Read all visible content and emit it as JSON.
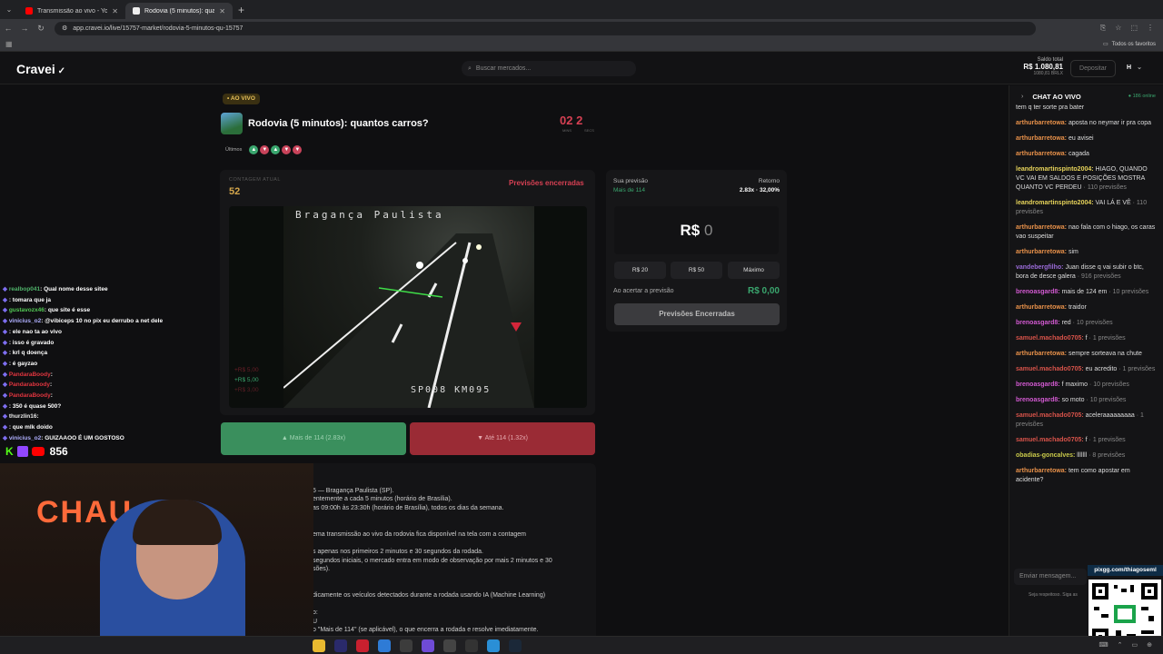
{
  "browser": {
    "tabs": [
      {
        "label": "Transmissão ao vivo - YouTube",
        "active": false
      },
      {
        "label": "Rodovia (5 minutos): quantos c",
        "active": true
      }
    ],
    "url": "app.cravei.io/live/15757-market/rodovia-5-minutos-qu-15757",
    "bookmarks_all": "Todos os favoritos"
  },
  "header": {
    "logo": "Cravei",
    "search_placeholder": "Buscar mercados...",
    "balance_label": "Saldo total",
    "balance_value": "R$ 1.080,81",
    "balance_sub": "1080,81 BRLX",
    "deposit_label": "Depositar",
    "avatar": "H"
  },
  "market": {
    "live_tag": "• AO VIVO",
    "title": "Rodovia (5 minutos): quantos carros?",
    "timer_min": "02",
    "timer_sec": "2",
    "timer_min_label": "MINS",
    "timer_sec_label": "SECS",
    "ultimos_label": "Últimos",
    "ultimos": [
      "up",
      "down",
      "up",
      "down",
      "down"
    ],
    "contagem_label": "CONTAGEM ATUAL",
    "contagem_value": "52",
    "status": "Previsões encerradas",
    "cam_top": "Bragança Paulista",
    "cam_bottom": "SP008 KM095",
    "odds": [
      "+R$ 5,00",
      "+R$ 5,00",
      "+R$ 3,00"
    ],
    "btn_mais": "Mais de 114 (2.83x)",
    "btn_ate": "Até 114 (1.32x)"
  },
  "description": [
    "5 — Bragança Paulista (SP).",
    "entemente a cada 5 minutos (horário de Brasília).",
    "as 09:00h às 23:30h (horário de Brasília), todos os dias da semana.",
    "ema transmissão ao vivo da rodovia fica disponível na tela com a contagem",
    "s apenas nos primeiros 2 minutos e 30 segundos da rodada.",
    "segundos iniciais, o mercado entra em modo de observação por mais 2 minutos e 30",
    "sões).",
    "dicamente os veículos detectados durante a rodada usando IA (Machine Learning)",
    "o:",
    "U",
    "o \"Mais de 114\" (se aplicável), o que encerra a rodada e resolve imediatamente."
  ],
  "prediction": {
    "sua_label": "Sua previsão",
    "sua_value": "Mais de 114",
    "retorno_label": "Retorno",
    "retorno_value": "2.83x · 32,00%",
    "amount_prefix": "R$",
    "amount_value": "0",
    "chips": [
      "R$ 20",
      "R$ 50",
      "Máximo"
    ],
    "ao_acertar_label": "Ao acertar a previsão",
    "ao_acertar_value": "R$ 0,00",
    "button": "Previsões Encerradas"
  },
  "chat": {
    "title": "CHAT AO VIVO",
    "online": "186 online",
    "messages": [
      {
        "user": "",
        "text": "tem q ter sorte pra bater",
        "color": "#dddddd",
        "pred": ""
      },
      {
        "user": "arthurbarretowa:",
        "text": " aposta no neymar ir pra copa",
        "color": "#e8914a",
        "pred": ""
      },
      {
        "user": "arthurbarretowa:",
        "text": " eu avisei",
        "color": "#e8914a",
        "pred": ""
      },
      {
        "user": "arthurbarretowa:",
        "text": " cagada",
        "color": "#e8914a",
        "pred": ""
      },
      {
        "user": "leandromartinspinto2004:",
        "text": " HIAGO, QUANDO VC VAI EM SALDOS E POSIÇÕES MOSTRA QUANTO VC PERDEU",
        "color": "#e6d35a",
        "pred": " · 110 previsões"
      },
      {
        "user": "leandromartinspinto2004:",
        "text": " VAI LÁ E VÊ",
        "color": "#e6d35a",
        "pred": " · 110 previsões"
      },
      {
        "user": "arthurbarretowa:",
        "text": " nao fala com o hiago, os caras vao suspeitar",
        "color": "#e8914a",
        "pred": ""
      },
      {
        "user": "arthurbarretowa:",
        "text": " sim",
        "color": "#e8914a",
        "pred": ""
      },
      {
        "user": "vandebergfilho:",
        "text": " Juan disse q vai subir o btc, bora de desce galera",
        "color": "#9a6bd8",
        "pred": " · 916 previsões"
      },
      {
        "user": "brenoasgard8:",
        "text": " mais de 124 em",
        "color": "#d35ad2",
        "pred": " · 10 previsões"
      },
      {
        "user": "arthurbarretowa:",
        "text": " traidor",
        "color": "#e8914a",
        "pred": ""
      },
      {
        "user": "brenoasgard8:",
        "text": " red",
        "color": "#d35ad2",
        "pred": " · 10 previsões"
      },
      {
        "user": "samuel.machado0705:",
        "text": " f",
        "color": "#d8534a",
        "pred": " · 1 previsões"
      },
      {
        "user": "arthurbarretowa:",
        "text": " sempre sorteava na chute",
        "color": "#e8914a",
        "pred": ""
      },
      {
        "user": "samuel.machado0705:",
        "text": " eu acredito",
        "color": "#d8534a",
        "pred": " · 1 previsões"
      },
      {
        "user": "brenoasgard8:",
        "text": " f maximo",
        "color": "#d35ad2",
        "pred": " · 10 previsões"
      },
      {
        "user": "brenoasgard8:",
        "text": " so moto",
        "color": "#d35ad2",
        "pred": " · 10 previsões"
      },
      {
        "user": "samuel.machado0705:",
        "text": " aceleraaaaaaaaa",
        "color": "#d8534a",
        "pred": " · 1 previsões"
      },
      {
        "user": "samuel.machado0705:",
        "text": " f",
        "color": "#d8534a",
        "pred": " · 1 previsões"
      },
      {
        "user": "obadias-goncalves:",
        "text": " lllllll",
        "color": "#c9c94a",
        "pred": " · 8 previsões"
      },
      {
        "user": "arthurbarretowa:",
        "text": " tem como apostar em acidente?",
        "color": "#e8914a",
        "pred": ""
      }
    ],
    "input_placeholder": "Enviar mensagem...",
    "note": "Seja respeitoso. Siga as",
    "qr_label": "pixgg.com/thiagoseml"
  },
  "overlay_chat": [
    {
      "name": "realbop041",
      "text": ": Qual nome desse sitee",
      "color": "#4fb26a"
    },
    {
      "name": "",
      "text": ": tomara que ja",
      "color": "#3b5bd8"
    },
    {
      "name": "gustavozx46",
      "text": ": que site é esse",
      "color": "#53c955"
    },
    {
      "name": "vinicius_o2",
      "text": ": @vibiceps 10 no pix eu derrubo a net dele",
      "color": "#b0b0ff"
    },
    {
      "name": "",
      "text": ": ele nao ta ao vivo",
      "color": "#3b5bd8"
    },
    {
      "name": "",
      "text": ": isso é gravado",
      "color": "#3b5bd8"
    },
    {
      "name": "",
      "text": ": krl q doença",
      "color": "#3b5bd8"
    },
    {
      "name": "",
      "text": ": é gayzao",
      "color": "#3b5bd8"
    },
    {
      "name": "PandaraBoody",
      "text": ":",
      "color": "#e0353f"
    },
    {
      "name": "Pandaraboody",
      "text": ":",
      "color": "#e0353f"
    },
    {
      "name": "PandaraBoody",
      "text": ":",
      "color": "#e0353f"
    },
    {
      "name": "",
      "text": ": 350 é quase 500?",
      "color": "#3b5bd8"
    },
    {
      "name": "thurzlin16",
      "text": ":",
      "color": "#e8e8e8"
    },
    {
      "name": "",
      "text": ": que mlk doido",
      "color": "#3b5bd8"
    },
    {
      "name": "vinicius_o2",
      "text": ": GUIZAAOO É UM GOSTOSO",
      "color": "#b0b0ff"
    }
  ],
  "viewers": "856",
  "webcam_sign": "CHAU"
}
